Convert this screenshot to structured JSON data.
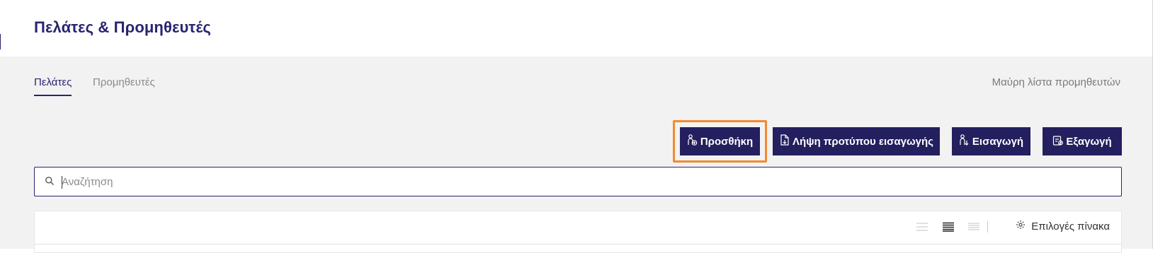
{
  "header": {
    "title": "Πελάτες & Προμηθευτές"
  },
  "tabs": [
    {
      "label": "Πελάτες",
      "active": true
    },
    {
      "label": "Προμηθευτές",
      "active": false
    }
  ],
  "blacklist_link": "Μαύρη λίστα προμηθευτών",
  "actions": {
    "add": {
      "label": "Προσθήκη",
      "icon": "person-add-icon"
    },
    "download_template": {
      "label": "Λήψη προτύπου εισαγωγής",
      "icon": "document-download-icon"
    },
    "import": {
      "label": "Εισαγωγή",
      "icon": "person-import-icon"
    },
    "export": {
      "label": "Εξαγωγή",
      "icon": "export-icon"
    }
  },
  "search": {
    "placeholder": "Αναζήτηση",
    "value": ""
  },
  "table_toolbar": {
    "density_options": [
      "compact",
      "standard",
      "comfortable"
    ],
    "selected_density": "standard",
    "options_label": "Επιλογές πίνακα"
  },
  "colors": {
    "primary": "#241f5e",
    "title": "#2a2470",
    "highlight": "#f28a30",
    "background": "#f2f2f2"
  }
}
